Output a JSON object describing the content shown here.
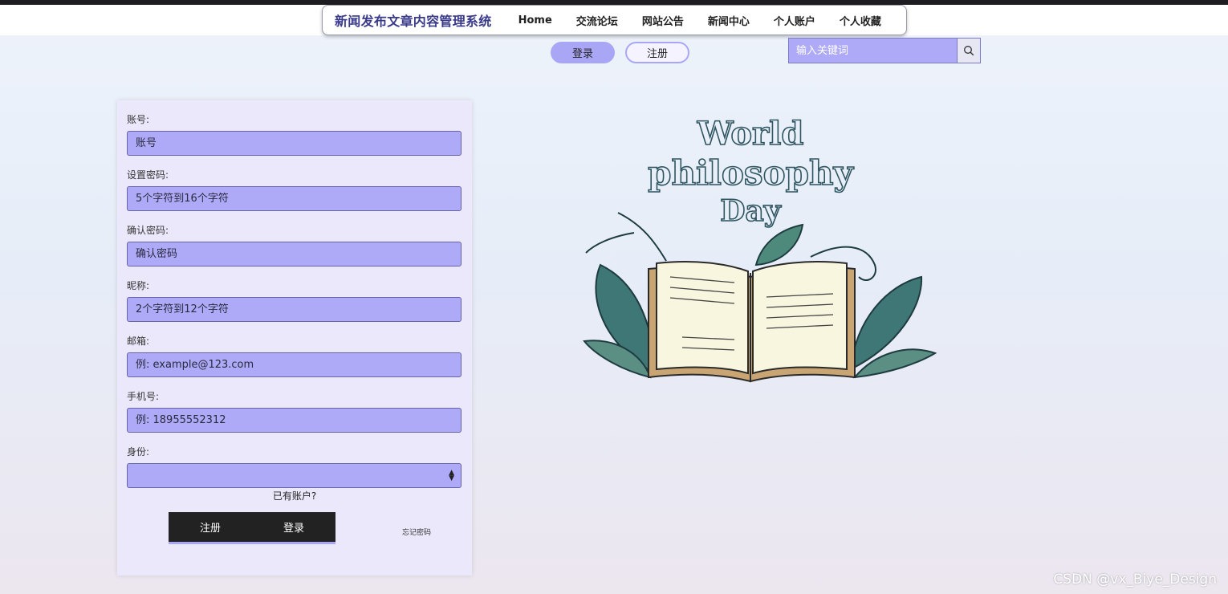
{
  "brand": "新闻发布文章内容管理系统",
  "nav": [
    "Home",
    "交流论坛",
    "网站公告",
    "新闻中心",
    "个人账户",
    "个人收藏"
  ],
  "auth": {
    "login": "登录",
    "register": "注册"
  },
  "search": {
    "placeholder": "输入关键词",
    "icon": "search-icon"
  },
  "form": {
    "fields": [
      {
        "label": "账号:",
        "placeholder": "账号"
      },
      {
        "label": "设置密码:",
        "placeholder": "5个字符到16个字符"
      },
      {
        "label": "确认密码:",
        "placeholder": "确认密码"
      },
      {
        "label": "昵称:",
        "placeholder": "2个字符到12个字符"
      },
      {
        "label": "邮箱:",
        "placeholder": "例: example@123.com"
      },
      {
        "label": "手机号:",
        "placeholder": "例: 18955552312"
      }
    ],
    "identity_label": "身份:",
    "identity_value": "",
    "have_account": "已有账户?",
    "register_button": "注册",
    "login_button": "登录",
    "forgot_password": "忘记密码"
  },
  "illustration": {
    "line1": "World",
    "line2": "philosophy",
    "line3": "Day"
  },
  "watermark": "CSDN @vx_Biye_Design",
  "colors": {
    "accent": "#aeaaf7",
    "dark": "#222222",
    "brand": "#3a3a8a"
  }
}
